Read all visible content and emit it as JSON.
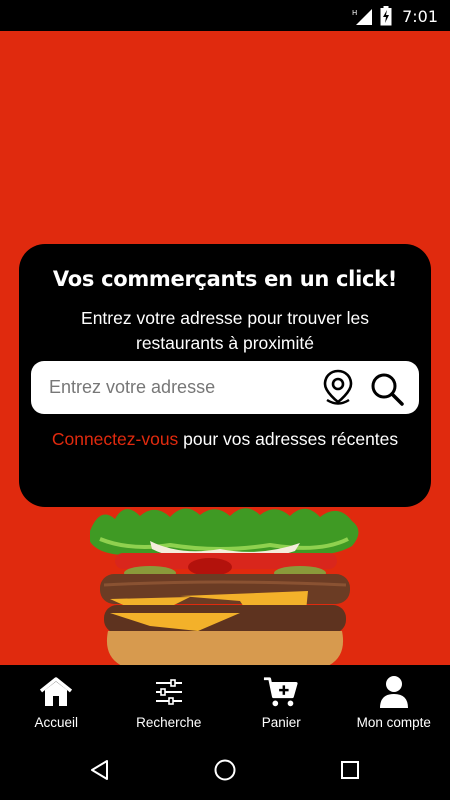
{
  "status_bar": {
    "time": "7:01"
  },
  "card": {
    "title": "Vos commerçants en un click!",
    "subtitle": "Entrez votre adresse pour trouver les restaurants à proximité",
    "search_placeholder": "Entrez votre adresse",
    "login_link": "Connectez-vous",
    "login_text": " pour vos adresses récentes"
  },
  "nav": {
    "items": [
      {
        "label": "Accueil",
        "icon": "home-icon"
      },
      {
        "label": "Recherche",
        "icon": "sliders-icon"
      },
      {
        "label": "Panier",
        "icon": "cart-icon"
      },
      {
        "label": "Mon compte",
        "icon": "user-icon"
      }
    ]
  },
  "colors": {
    "accent": "#e02a0e",
    "card": "#000000"
  }
}
